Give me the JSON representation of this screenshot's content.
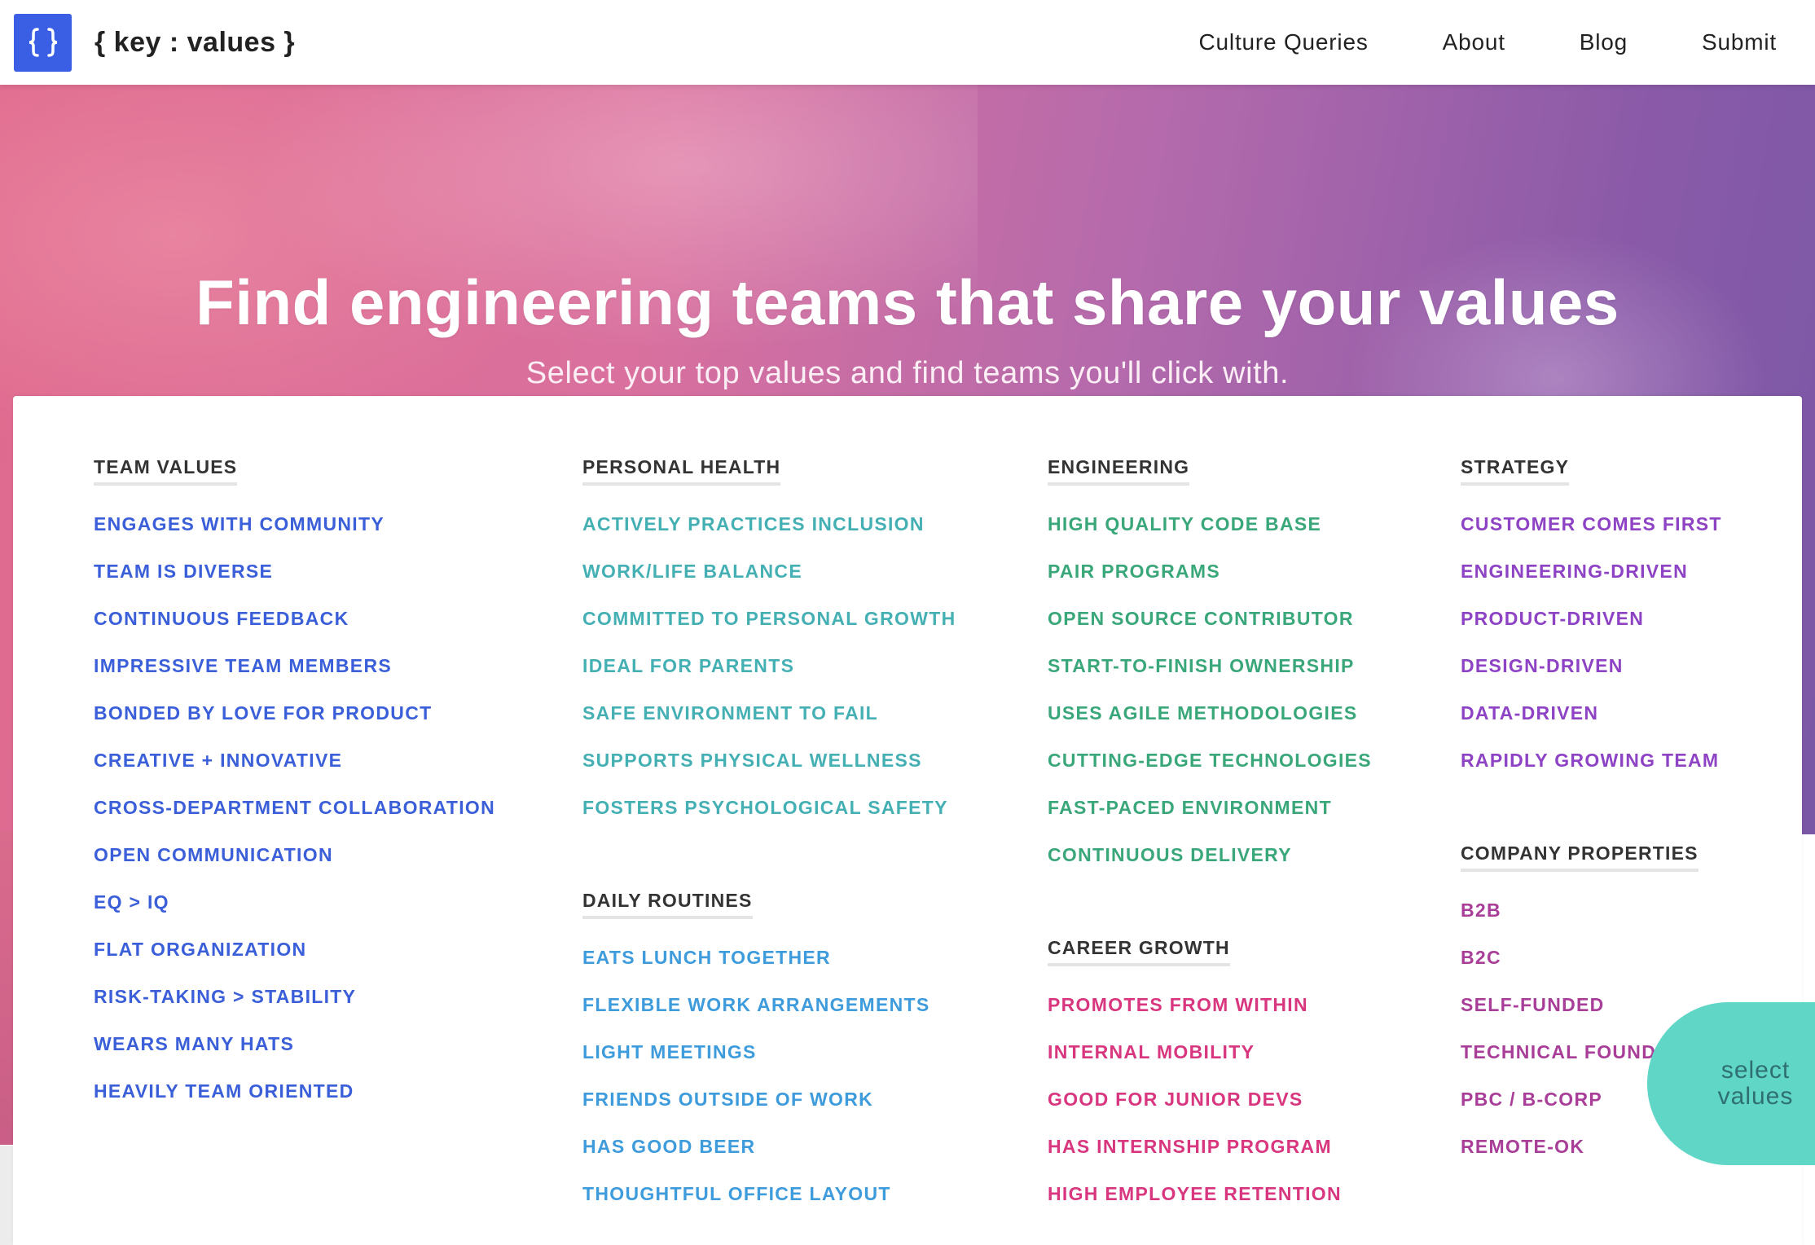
{
  "header": {
    "brand": "{ key : values }",
    "nav": [
      "Culture Queries",
      "About",
      "Blog",
      "Submit"
    ]
  },
  "hero": {
    "title": "Find engineering teams that share your values",
    "subtitle": "Select your top values and find teams you'll click with."
  },
  "colors": {
    "logo_blue": "#3a5fe5",
    "team_values": "#3a5fd8",
    "personal_health": "#45b0b4",
    "daily_routines": "#3e9bdc",
    "engineering": "#3aa77a",
    "career_growth": "#d8367f",
    "strategy": "#8d43c4",
    "company_properties": "#a83e98",
    "fab": "#5fd6c6"
  },
  "columns": [
    {
      "sections": [
        {
          "title": "TEAM VALUES",
          "color_key": "team_values",
          "items": [
            "ENGAGES WITH COMMUNITY",
            "TEAM IS DIVERSE",
            "CONTINUOUS FEEDBACK",
            "IMPRESSIVE TEAM MEMBERS",
            "BONDED BY LOVE FOR PRODUCT",
            "CREATIVE + INNOVATIVE",
            "CROSS-DEPARTMENT COLLABORATION",
            "OPEN COMMUNICATION",
            "EQ > IQ",
            "FLAT ORGANIZATION",
            "RISK-TAKING > STABILITY",
            "WEARS MANY HATS",
            "HEAVILY TEAM ORIENTED"
          ]
        }
      ]
    },
    {
      "sections": [
        {
          "title": "PERSONAL HEALTH",
          "color_key": "personal_health",
          "items": [
            "ACTIVELY PRACTICES INCLUSION",
            "WORK/LIFE BALANCE",
            "COMMITTED TO PERSONAL GROWTH",
            "IDEAL FOR PARENTS",
            "SAFE ENVIRONMENT TO FAIL",
            "SUPPORTS PHYSICAL WELLNESS",
            "FOSTERS PSYCHOLOGICAL SAFETY"
          ]
        },
        {
          "title": "DAILY ROUTINES",
          "color_key": "daily_routines",
          "items": [
            "EATS LUNCH TOGETHER",
            "FLEXIBLE WORK ARRANGEMENTS",
            "LIGHT MEETINGS",
            "FRIENDS OUTSIDE OF WORK",
            "HAS GOOD BEER",
            "THOUGHTFUL OFFICE LAYOUT"
          ]
        }
      ]
    },
    {
      "sections": [
        {
          "title": "ENGINEERING",
          "color_key": "engineering",
          "items": [
            "HIGH QUALITY CODE BASE",
            "PAIR PROGRAMS",
            "OPEN SOURCE CONTRIBUTOR",
            "START-TO-FINISH OWNERSHIP",
            "USES AGILE METHODOLOGIES",
            "CUTTING-EDGE TECHNOLOGIES",
            "FAST-PACED ENVIRONMENT",
            "CONTINUOUS DELIVERY"
          ]
        },
        {
          "title": "CAREER GROWTH",
          "color_key": "career_growth",
          "items": [
            "PROMOTES FROM WITHIN",
            "INTERNAL MOBILITY",
            "GOOD FOR JUNIOR DEVS",
            "HAS INTERNSHIP PROGRAM",
            "HIGH EMPLOYEE RETENTION"
          ]
        }
      ]
    },
    {
      "sections": [
        {
          "title": "STRATEGY",
          "color_key": "strategy",
          "items": [
            "CUSTOMER COMES FIRST",
            "ENGINEERING-DRIVEN",
            "PRODUCT-DRIVEN",
            "DESIGN-DRIVEN",
            "DATA-DRIVEN",
            "RAPIDLY GROWING TEAM"
          ]
        },
        {
          "title": "COMPANY PROPERTIES",
          "color_key": "company_properties",
          "items": [
            "B2B",
            "B2C",
            "SELF-FUNDED",
            "TECHNICAL FOUNDERS",
            "PBC / B-CORP",
            "REMOTE-OK"
          ]
        }
      ]
    }
  ],
  "fab": {
    "label": "select values"
  }
}
